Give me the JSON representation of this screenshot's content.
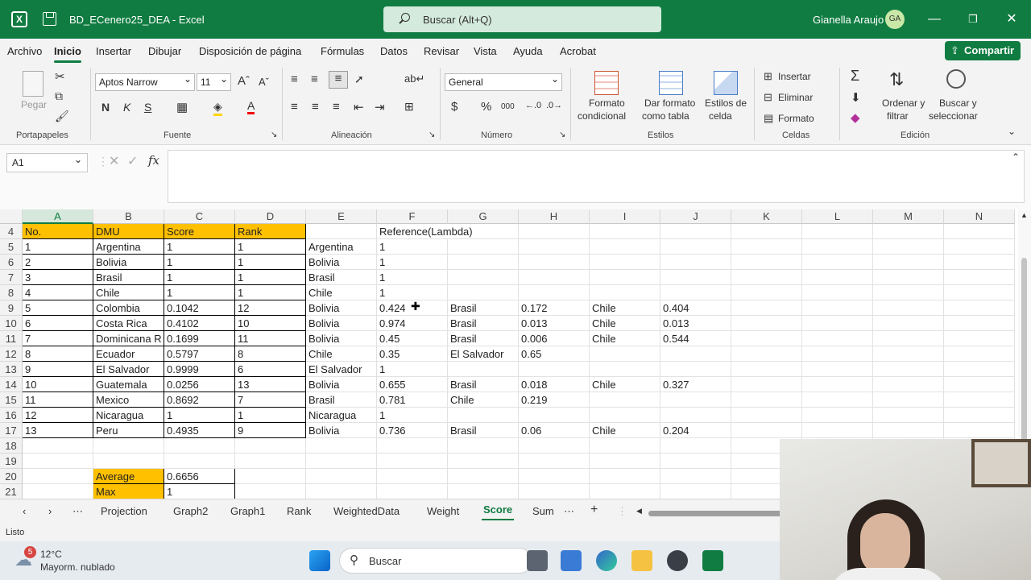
{
  "window": {
    "title": "BD_ECenero25_DEA  -  Excel",
    "search_placeholder": "Buscar (Alt+Q)",
    "user_name": "Gianella Araujo",
    "user_initials": "GA",
    "logo_letter": "X"
  },
  "menu": [
    "Archivo",
    "Inicio",
    "Insertar",
    "Dibujar",
    "Disposición de página",
    "Fórmulas",
    "Datos",
    "Revisar",
    "Vista",
    "Ayuda",
    "Acrobat"
  ],
  "share_label": "Compartir",
  "ribbon": {
    "clipboard": {
      "paste": "Pegar",
      "group": "Portapapeles"
    },
    "font": {
      "name": "Aptos Narrow",
      "size": "11",
      "group": "Fuente",
      "bold": "N",
      "italic": "K",
      "underline": "S"
    },
    "alignment": {
      "group": "Alineación"
    },
    "number": {
      "format": "General",
      "group": "Número",
      "currency": "$",
      "percent": "%",
      "thousands": "000"
    },
    "styles": {
      "cond_format_1": "Formato",
      "cond_format_2": "condicional",
      "table_format_1": "Dar formato",
      "table_format_2": "como tabla",
      "cell_styles_1": "Estilos de",
      "cell_styles_2": "celda",
      "group": "Estilos"
    },
    "cells": {
      "insert": "Insertar",
      "delete": "Eliminar",
      "format": "Formato",
      "group": "Celdas"
    },
    "editing": {
      "sort_1": "Ordenar y",
      "sort_2": "filtrar",
      "find_1": "Buscar y",
      "find_2": "seleccionar",
      "group": "Edición"
    }
  },
  "formula_bar": {
    "name_box": "A1",
    "fx": "fx",
    "content": ""
  },
  "grid": {
    "columns": [
      "A",
      "B",
      "C",
      "D",
      "E",
      "F",
      "G",
      "H",
      "I",
      "J",
      "K",
      "L",
      "M",
      "N"
    ],
    "selected_column": "A",
    "rows": [
      {
        "n": "4",
        "cells": [
          "No.",
          "DMU",
          "Score",
          "Rank",
          "",
          "Reference(Lambda)",
          "",
          "",
          "",
          ""
        ]
      },
      {
        "n": "5",
        "cells": [
          "1",
          "Argentina",
          "1",
          "1",
          "Argentina",
          "1",
          "",
          "",
          "",
          ""
        ]
      },
      {
        "n": "6",
        "cells": [
          "2",
          "Bolivia",
          "1",
          "1",
          "Bolivia",
          "1",
          "",
          "",
          "",
          ""
        ]
      },
      {
        "n": "7",
        "cells": [
          "3",
          "Brasil",
          "1",
          "1",
          "Brasil",
          "1",
          "",
          "",
          "",
          ""
        ]
      },
      {
        "n": "8",
        "cells": [
          "4",
          "Chile",
          "1",
          "1",
          "Chile",
          "1",
          "",
          "",
          "",
          ""
        ]
      },
      {
        "n": "9",
        "cells": [
          "5",
          "Colombia",
          "0.1042",
          "12",
          "Bolivia",
          "0.424",
          "Brasil",
          "0.172",
          "Chile",
          "0.404"
        ]
      },
      {
        "n": "10",
        "cells": [
          "6",
          "Costa Rica",
          "0.4102",
          "10",
          "Bolivia",
          "0.974",
          "Brasil",
          "0.013",
          "Chile",
          "0.013"
        ]
      },
      {
        "n": "11",
        "cells": [
          "7",
          "Dominicana R",
          "0.1699",
          "11",
          "Bolivia",
          "0.45",
          "Brasil",
          "0.006",
          "Chile",
          "0.544"
        ]
      },
      {
        "n": "12",
        "cells": [
          "8",
          "Ecuador",
          "0.5797",
          "8",
          "Chile",
          "0.35",
          "El Salvador",
          "0.65",
          "",
          ""
        ]
      },
      {
        "n": "13",
        "cells": [
          "9",
          "El Salvador",
          "0.9999",
          "6",
          "El Salvador",
          "1",
          "",
          "",
          "",
          ""
        ]
      },
      {
        "n": "14",
        "cells": [
          "10",
          "Guatemala",
          "0.0256",
          "13",
          "Bolivia",
          "0.655",
          "Brasil",
          "0.018",
          "Chile",
          "0.327"
        ]
      },
      {
        "n": "15",
        "cells": [
          "11",
          "Mexico",
          "0.8692",
          "7",
          "Brasil",
          "0.781",
          "Chile",
          "0.219",
          "",
          ""
        ]
      },
      {
        "n": "16",
        "cells": [
          "12",
          "Nicaragua",
          "1",
          "1",
          "Nicaragua",
          "1",
          "",
          "",
          "",
          ""
        ]
      },
      {
        "n": "17",
        "cells": [
          "13",
          "Peru",
          "0.4935",
          "9",
          "Bolivia",
          "0.736",
          "Brasil",
          "0.06",
          "Chile",
          "0.204"
        ]
      },
      {
        "n": "18",
        "cells": [
          "",
          "",
          "",
          "",
          "",
          "",
          "",
          "",
          "",
          ""
        ]
      },
      {
        "n": "19",
        "cells": [
          "",
          "",
          "",
          "",
          "",
          "",
          "",
          "",
          "",
          ""
        ]
      },
      {
        "n": "20",
        "cells": [
          "",
          "Average",
          "0.6656",
          "",
          "",
          "",
          "",
          "",
          "",
          ""
        ]
      },
      {
        "n": "21",
        "cells": [
          "",
          "Max",
          "1",
          "",
          "",
          "",
          "",
          "",
          "",
          ""
        ]
      }
    ]
  },
  "sheets": [
    "Projection",
    "Graph2",
    "Graph1",
    "Rank",
    "WeightedData",
    "Weight",
    "Score",
    "Sum"
  ],
  "active_sheet": "Score",
  "status": "Listo",
  "taskbar": {
    "weather_temp": "12°C",
    "weather_desc": "Mayorm. nublado",
    "weather_badge": "5",
    "search": "Buscar"
  },
  "colors": {
    "accent": "#107c41",
    "header_fill": "#ffc000"
  }
}
